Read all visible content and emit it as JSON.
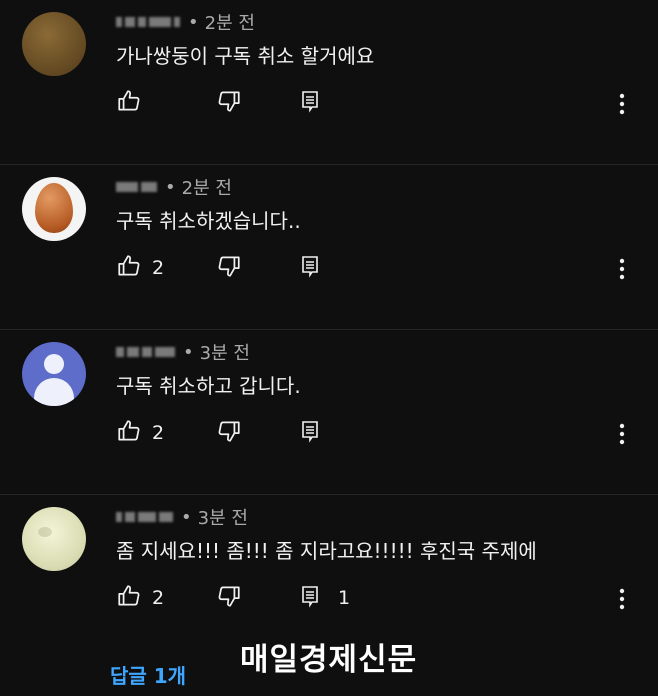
{
  "comments": [
    {
      "time": "2분 전",
      "dot": "•",
      "text": "가나쌍둥이 구독 취소 할거에요",
      "likes": "",
      "replies": ""
    },
    {
      "time": "2분 전",
      "dot": "•",
      "text": "구독 취소하겠습니다..",
      "likes": "2",
      "replies": ""
    },
    {
      "time": "3분 전",
      "dot": "•",
      "text": "구독 취소하고 갑니다.",
      "likes": "2",
      "replies": ""
    },
    {
      "time": "3분 전",
      "dot": "•",
      "text": "좀 지세요!!! 좀!!! 좀 지라고요!!!!! 후진국 주제에",
      "likes": "2",
      "replies": "1"
    }
  ],
  "replies_link": "답글 1개",
  "watermark": "매일경제신문",
  "icons": [
    "thumb-up-icon",
    "thumb-down-icon",
    "reply-icon",
    "more-vertical-icon"
  ]
}
